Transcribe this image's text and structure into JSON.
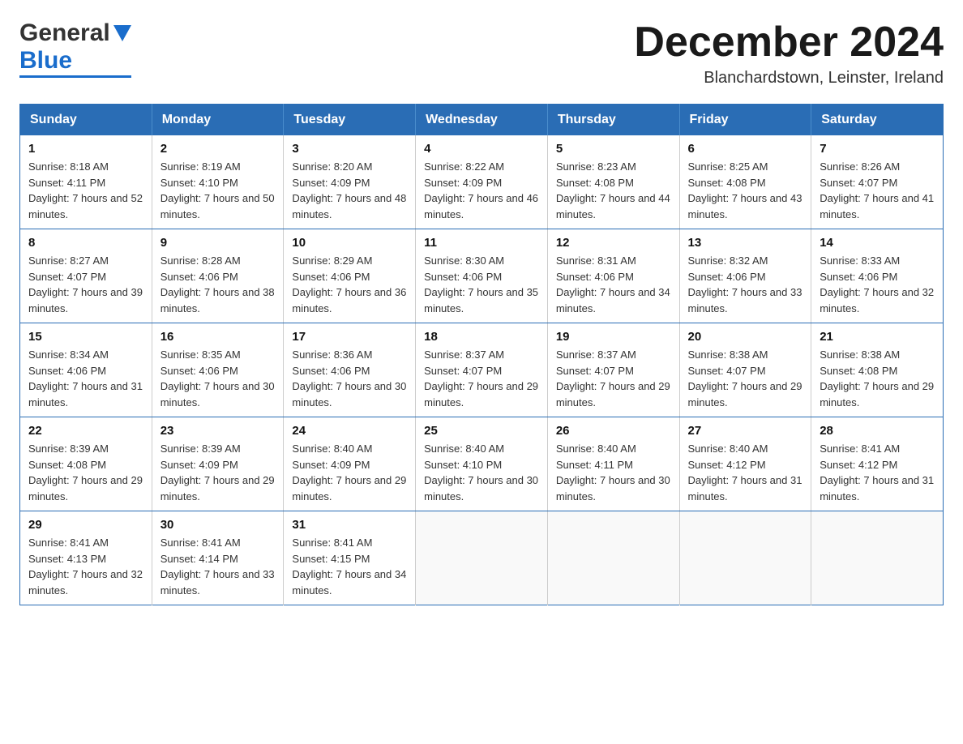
{
  "header": {
    "logo_general": "General",
    "logo_blue": "Blue",
    "month_title": "December 2024",
    "location": "Blanchardstown, Leinster, Ireland"
  },
  "days_of_week": [
    "Sunday",
    "Monday",
    "Tuesday",
    "Wednesday",
    "Thursday",
    "Friday",
    "Saturday"
  ],
  "weeks": [
    [
      {
        "day": "1",
        "sunrise": "8:18 AM",
        "sunset": "4:11 PM",
        "daylight": "7 hours and 52 minutes."
      },
      {
        "day": "2",
        "sunrise": "8:19 AM",
        "sunset": "4:10 PM",
        "daylight": "7 hours and 50 minutes."
      },
      {
        "day": "3",
        "sunrise": "8:20 AM",
        "sunset": "4:09 PM",
        "daylight": "7 hours and 48 minutes."
      },
      {
        "day": "4",
        "sunrise": "8:22 AM",
        "sunset": "4:09 PM",
        "daylight": "7 hours and 46 minutes."
      },
      {
        "day": "5",
        "sunrise": "8:23 AM",
        "sunset": "4:08 PM",
        "daylight": "7 hours and 44 minutes."
      },
      {
        "day": "6",
        "sunrise": "8:25 AM",
        "sunset": "4:08 PM",
        "daylight": "7 hours and 43 minutes."
      },
      {
        "day": "7",
        "sunrise": "8:26 AM",
        "sunset": "4:07 PM",
        "daylight": "7 hours and 41 minutes."
      }
    ],
    [
      {
        "day": "8",
        "sunrise": "8:27 AM",
        "sunset": "4:07 PM",
        "daylight": "7 hours and 39 minutes."
      },
      {
        "day": "9",
        "sunrise": "8:28 AM",
        "sunset": "4:06 PM",
        "daylight": "7 hours and 38 minutes."
      },
      {
        "day": "10",
        "sunrise": "8:29 AM",
        "sunset": "4:06 PM",
        "daylight": "7 hours and 36 minutes."
      },
      {
        "day": "11",
        "sunrise": "8:30 AM",
        "sunset": "4:06 PM",
        "daylight": "7 hours and 35 minutes."
      },
      {
        "day": "12",
        "sunrise": "8:31 AM",
        "sunset": "4:06 PM",
        "daylight": "7 hours and 34 minutes."
      },
      {
        "day": "13",
        "sunrise": "8:32 AM",
        "sunset": "4:06 PM",
        "daylight": "7 hours and 33 minutes."
      },
      {
        "day": "14",
        "sunrise": "8:33 AM",
        "sunset": "4:06 PM",
        "daylight": "7 hours and 32 minutes."
      }
    ],
    [
      {
        "day": "15",
        "sunrise": "8:34 AM",
        "sunset": "4:06 PM",
        "daylight": "7 hours and 31 minutes."
      },
      {
        "day": "16",
        "sunrise": "8:35 AM",
        "sunset": "4:06 PM",
        "daylight": "7 hours and 30 minutes."
      },
      {
        "day": "17",
        "sunrise": "8:36 AM",
        "sunset": "4:06 PM",
        "daylight": "7 hours and 30 minutes."
      },
      {
        "day": "18",
        "sunrise": "8:37 AM",
        "sunset": "4:07 PM",
        "daylight": "7 hours and 29 minutes."
      },
      {
        "day": "19",
        "sunrise": "8:37 AM",
        "sunset": "4:07 PM",
        "daylight": "7 hours and 29 minutes."
      },
      {
        "day": "20",
        "sunrise": "8:38 AM",
        "sunset": "4:07 PM",
        "daylight": "7 hours and 29 minutes."
      },
      {
        "day": "21",
        "sunrise": "8:38 AM",
        "sunset": "4:08 PM",
        "daylight": "7 hours and 29 minutes."
      }
    ],
    [
      {
        "day": "22",
        "sunrise": "8:39 AM",
        "sunset": "4:08 PM",
        "daylight": "7 hours and 29 minutes."
      },
      {
        "day": "23",
        "sunrise": "8:39 AM",
        "sunset": "4:09 PM",
        "daylight": "7 hours and 29 minutes."
      },
      {
        "day": "24",
        "sunrise": "8:40 AM",
        "sunset": "4:09 PM",
        "daylight": "7 hours and 29 minutes."
      },
      {
        "day": "25",
        "sunrise": "8:40 AM",
        "sunset": "4:10 PM",
        "daylight": "7 hours and 30 minutes."
      },
      {
        "day": "26",
        "sunrise": "8:40 AM",
        "sunset": "4:11 PM",
        "daylight": "7 hours and 30 minutes."
      },
      {
        "day": "27",
        "sunrise": "8:40 AM",
        "sunset": "4:12 PM",
        "daylight": "7 hours and 31 minutes."
      },
      {
        "day": "28",
        "sunrise": "8:41 AM",
        "sunset": "4:12 PM",
        "daylight": "7 hours and 31 minutes."
      }
    ],
    [
      {
        "day": "29",
        "sunrise": "8:41 AM",
        "sunset": "4:13 PM",
        "daylight": "7 hours and 32 minutes."
      },
      {
        "day": "30",
        "sunrise": "8:41 AM",
        "sunset": "4:14 PM",
        "daylight": "7 hours and 33 minutes."
      },
      {
        "day": "31",
        "sunrise": "8:41 AM",
        "sunset": "4:15 PM",
        "daylight": "7 hours and 34 minutes."
      },
      null,
      null,
      null,
      null
    ]
  ],
  "labels": {
    "sunrise_prefix": "Sunrise: ",
    "sunset_prefix": "Sunset: ",
    "daylight_prefix": "Daylight: "
  }
}
